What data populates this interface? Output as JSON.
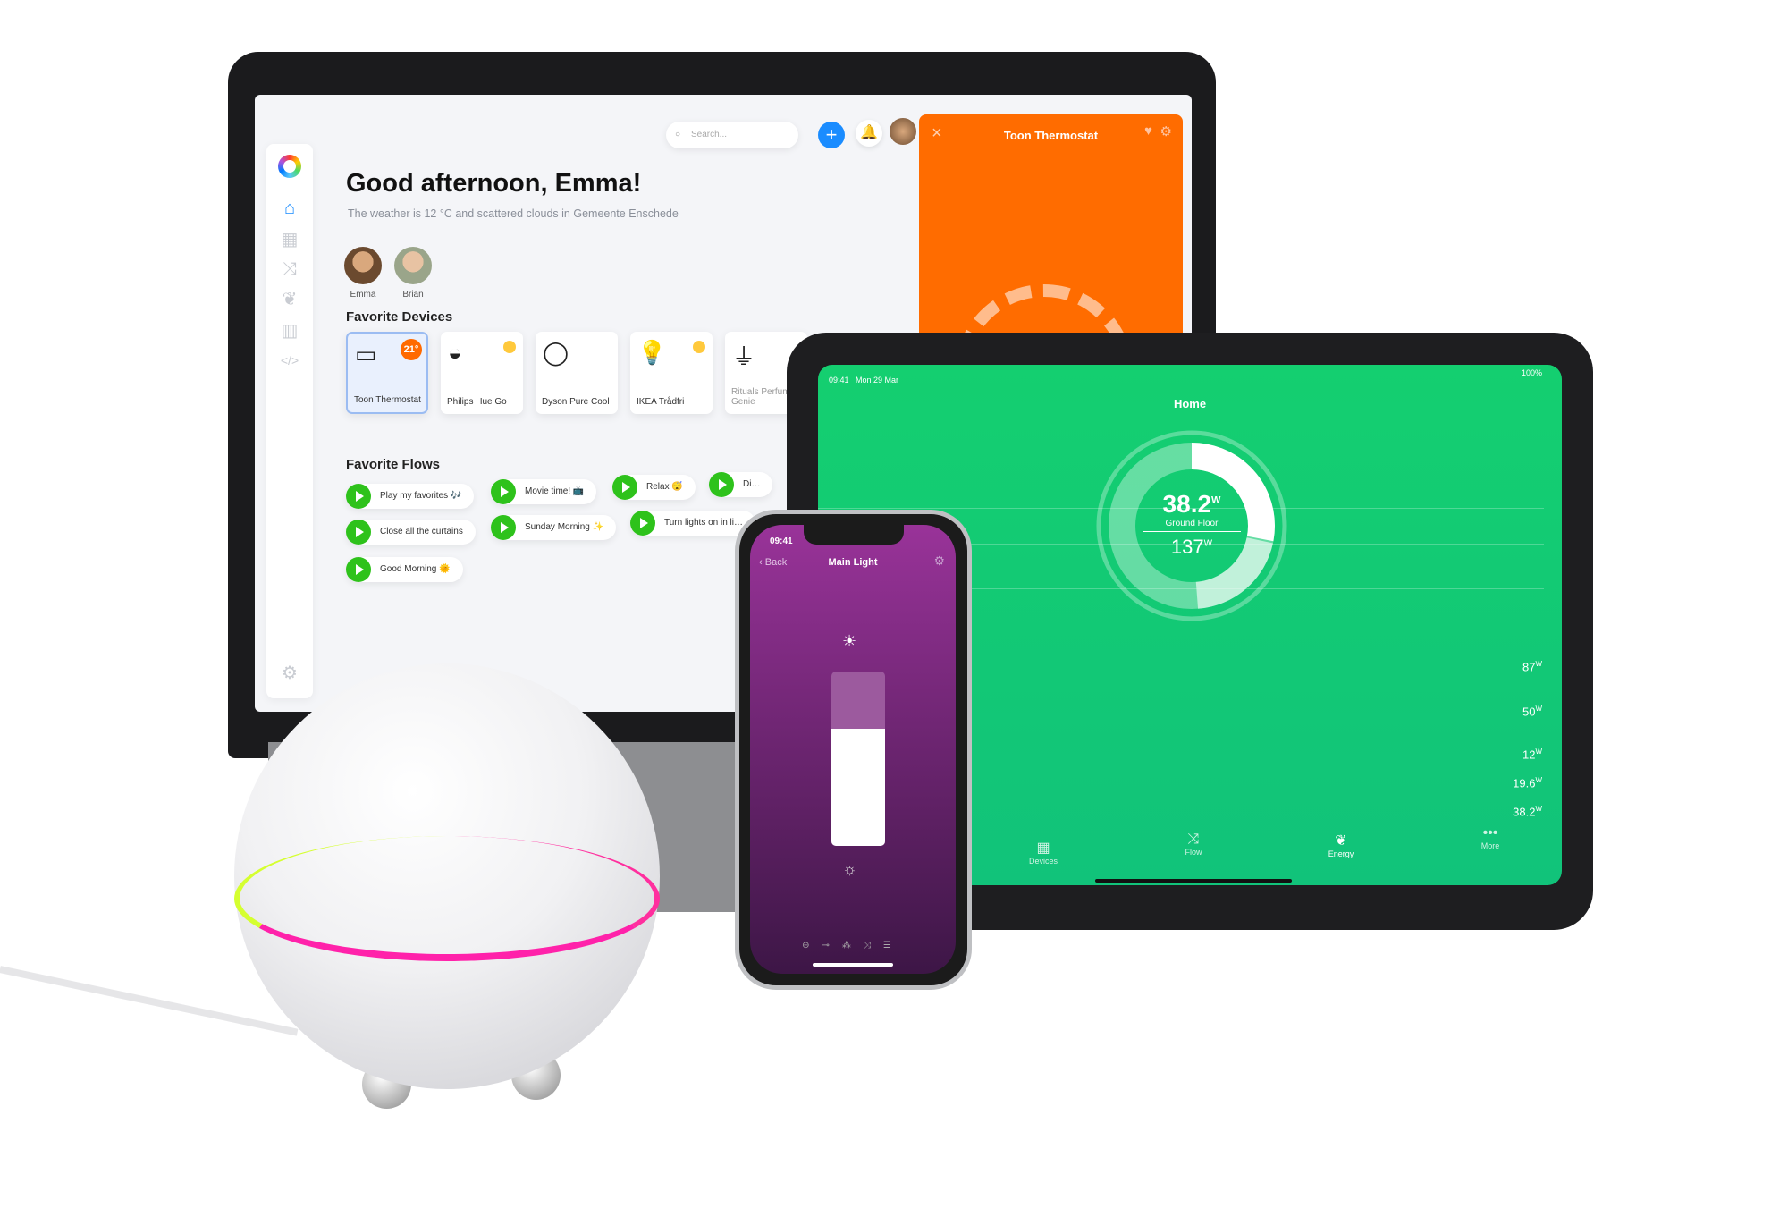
{
  "laptop": {
    "sidebar": {
      "items": [
        {
          "name": "home",
          "icon": "home-icon",
          "active": true
        },
        {
          "name": "devices",
          "icon": "grid-icon"
        },
        {
          "name": "flows",
          "icon": "shuffle-icon"
        },
        {
          "name": "energy",
          "icon": "leaf-icon"
        },
        {
          "name": "insights",
          "icon": "bar-chart-icon"
        },
        {
          "name": "developer",
          "icon": "code-icon"
        },
        {
          "name": "settings",
          "icon": "gear-icon"
        }
      ]
    },
    "search_placeholder": "Search...",
    "greeting": "Good afternoon, Emma!",
    "weather": "The weather is 12 °C and scattered clouds in Gemeente Enschede",
    "users": [
      "Emma",
      "Brian"
    ],
    "favorite_devices_title": "Favorite Devices",
    "devices": [
      {
        "name": "Toon Thermostat",
        "badge": "21°",
        "selected": true
      },
      {
        "name": "Philips Hue Go",
        "on": true
      },
      {
        "name": "Dyson Pure Cool"
      },
      {
        "name": "IKEA Trådfri",
        "on": true
      },
      {
        "name": "Rituals Perfume Genie"
      }
    ],
    "favorite_flows_title": "Favorite Flows",
    "flows": [
      "Play my favorites 🎶",
      "Movie time! 📺",
      "Relax 😴",
      "Di…",
      "Close all the curtains",
      "Sunday Morning ✨",
      "Turn lights on in li…",
      "Good Morning 🌞"
    ],
    "panel": {
      "title": "Toon Thermostat",
      "color": "#ff6c00"
    },
    "accent": "#1a8cff"
  },
  "tablet": {
    "time": "09:41",
    "date": "Mon 29 Mar",
    "battery": "100%",
    "title": "Home",
    "current": "38.2",
    "unit": "W",
    "label": "Ground Floor",
    "total": "137",
    "rows": [
      "87",
      "50",
      "12",
      "19.6",
      "38.2"
    ],
    "tabs": [
      "Devices",
      "Flow",
      "Energy",
      "More"
    ],
    "color": "#14cf70"
  },
  "phone": {
    "time": "09:41",
    "back": "Back",
    "title": "Main Light",
    "brightness": 0.67,
    "color": "#993399"
  }
}
